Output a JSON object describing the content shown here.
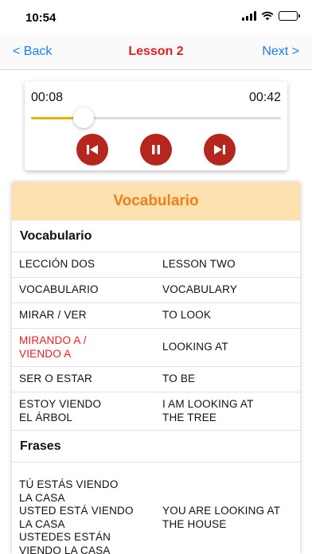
{
  "status_bar": {
    "time": "10:54"
  },
  "nav": {
    "back_label": "< Back",
    "title": "Lesson 2",
    "next_label": "Next >"
  },
  "player": {
    "current_time": "00:08",
    "total_time": "00:42",
    "progress": 0.21,
    "accent_color": "#e2b400",
    "button_color": "#b5261f",
    "controls": [
      "previous-icon",
      "pause-icon",
      "next-icon"
    ]
  },
  "vocab_panel": {
    "header": "Vocabulario",
    "header_color": "#f07e1a",
    "header_bg": "#fde2b0",
    "section_vocab": "Vocabulario",
    "vocab_rows": [
      {
        "es": "LECCIÓN DOS",
        "en": "LESSON TWO"
      },
      {
        "es": "VOCABULARIO",
        "en": "VOCABULARY"
      },
      {
        "es": "MIRAR / VER",
        "en": "TO LOOK"
      },
      {
        "es": "MIRANDO A /\nVIENDO A",
        "en": "LOOKING AT"
      },
      {
        "es": "SER O ESTAR",
        "en": "TO BE"
      },
      {
        "es": "ESTOY VIENDO\nEL ÁRBOL",
        "en": "I AM LOOKING AT\nTHE TREE"
      }
    ],
    "section_phrases": "Frases",
    "phrase_rows": [
      {
        "es": "TÚ ESTÁS VIENDO\nLA CASA\nUSTED ESTÁ VIENDO\nLA CASA\nUSTEDES ESTÁN\nVIENDO LA CASA",
        "en": "YOU ARE LOOKING AT\nTHE HOUSE"
      }
    ]
  }
}
